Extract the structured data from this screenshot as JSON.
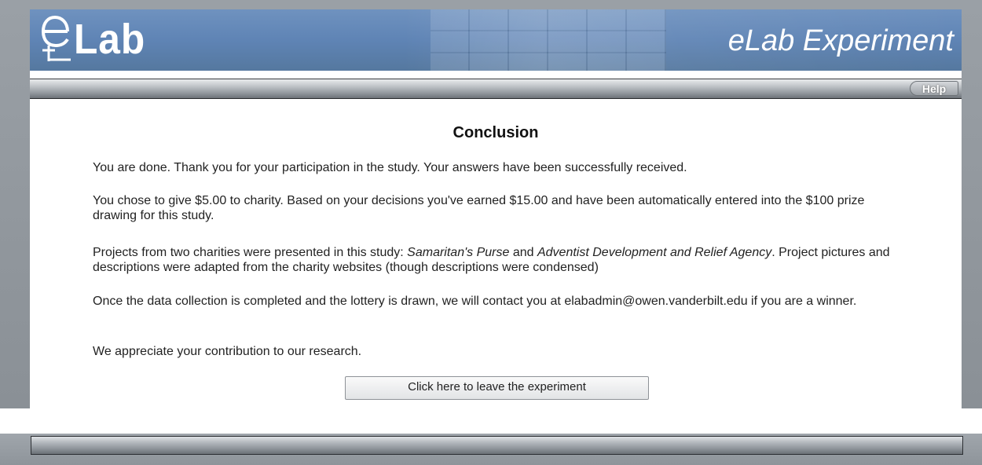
{
  "banner": {
    "logo_text": "Lab",
    "title": "eLab Experiment"
  },
  "toolbar": {
    "help_label": "Help"
  },
  "conclusion": {
    "heading": "Conclusion",
    "p1": "You are done. Thank you for your participation in the study. Your answers have been successfully received.",
    "p2": "You chose to give $5.00 to charity. Based on your decisions you've earned $15.00 and have been automatically entered into the $100 prize drawing for this study.",
    "p3_before": "Projects from two charities were presented in this study: ",
    "charity1": "Samaritan's Purse",
    "p3_and": " and ",
    "charity2": "Adventist Development and Relief Agency",
    "p3_after": ". Project pictures and descriptions were adapted from the charity websites (though descriptions were condensed)",
    "p4": "Once the data collection is completed and the lottery is drawn, we will contact you at elabadmin@owen.vanderbilt.edu if you are a winner.",
    "p5": "We appreciate your contribution to our research.",
    "leave_button": "Click here to leave the experiment"
  },
  "icons": [
    "elab-logo-icon"
  ],
  "colors": {
    "banner_blue": "#6f92bf",
    "frame_gray": "#9aa0a6"
  }
}
